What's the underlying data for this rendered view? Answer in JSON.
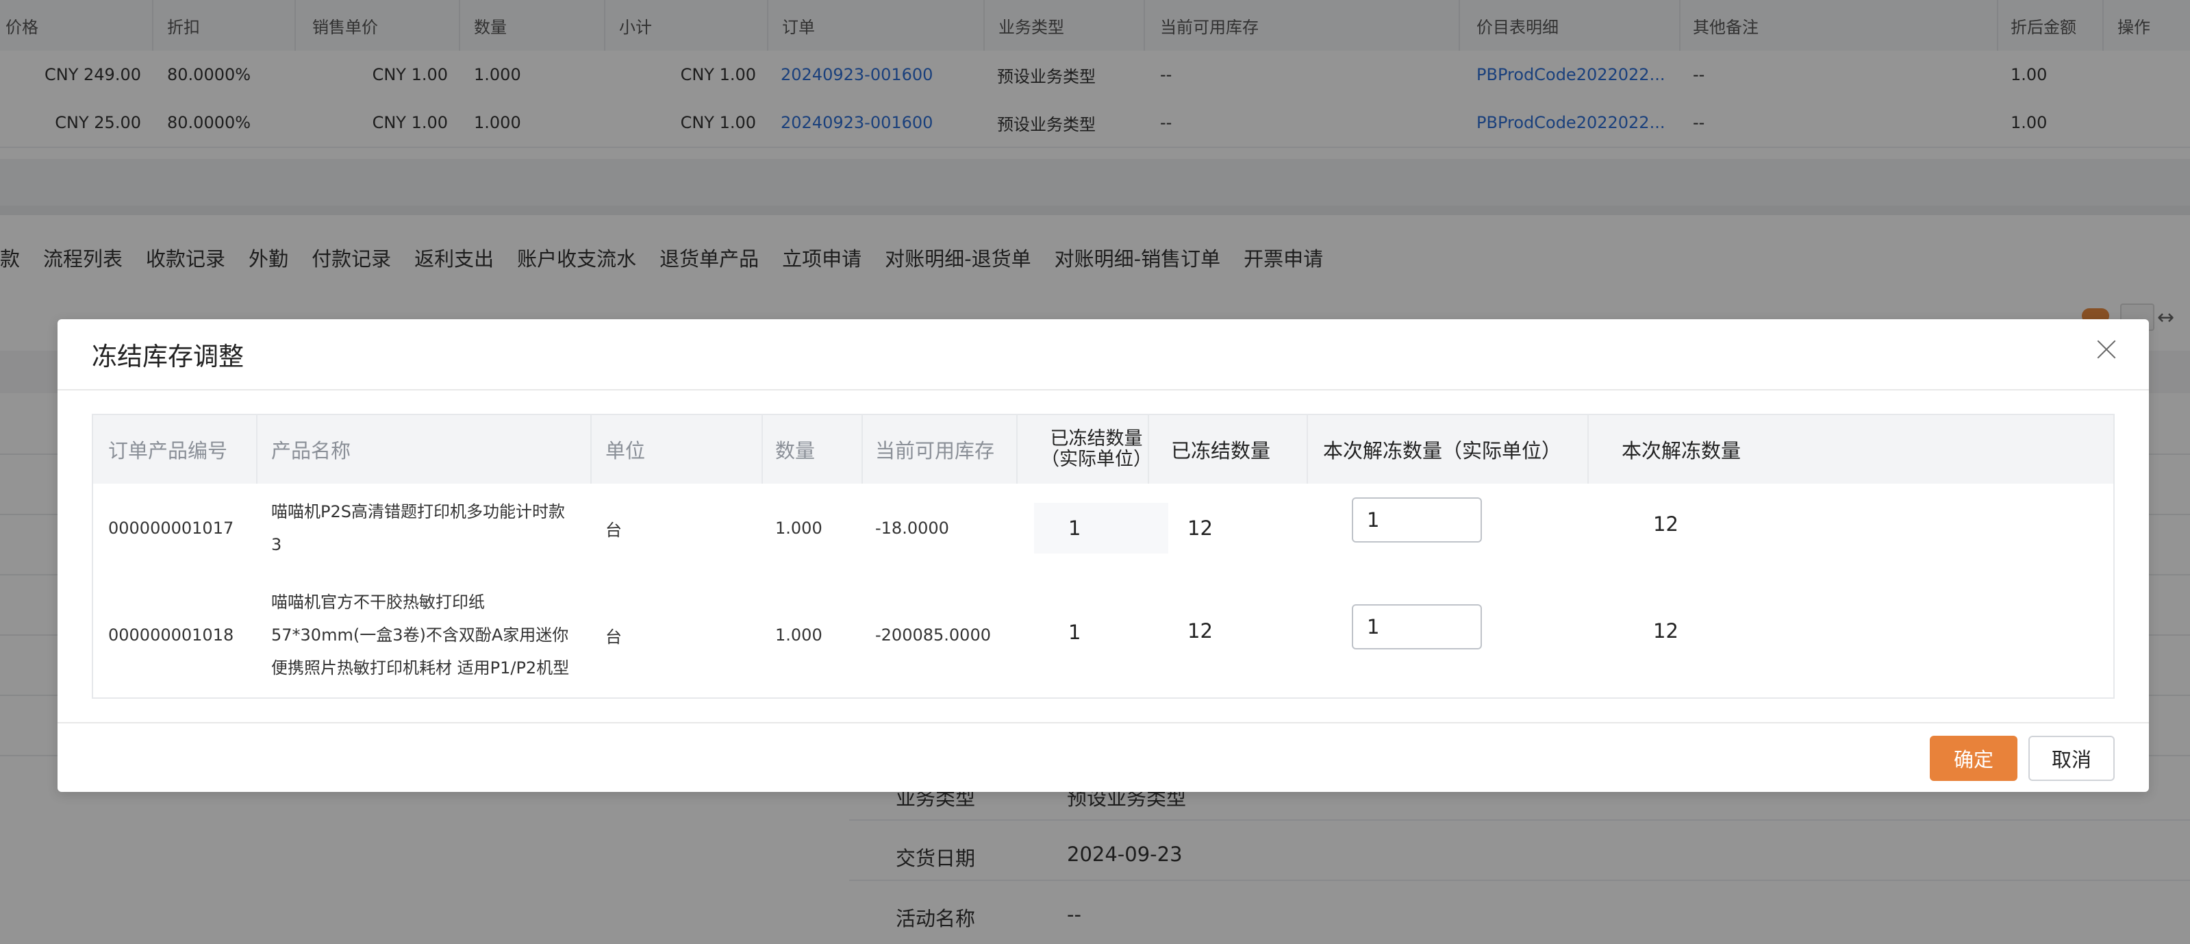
{
  "background_table": {
    "headers": [
      "价格",
      "折扣",
      "销售单价",
      "数量",
      "小计",
      "订单",
      "业务类型",
      "当前可用库存",
      "价目表明细",
      "其他备注",
      "折后金额",
      "操作"
    ],
    "rows": [
      [
        "CNY 249.00",
        "80.0000%",
        "CNY 1.00",
        "1.000",
        "CNY 1.00",
        "20240923-001600",
        "预设业务类型",
        "--",
        "PBProdCode2022022...",
        "--",
        "1.00",
        ""
      ],
      [
        "CNY 25.00",
        "80.0000%",
        "CNY 1.00",
        "1.000",
        "CNY 1.00",
        "20240923-001600",
        "预设业务类型",
        "--",
        "PBProdCode2022022...",
        "--",
        "1.00",
        ""
      ]
    ]
  },
  "tabs": [
    "款",
    "流程列表",
    "收款记录",
    "外勤",
    "付款记录",
    "返利支出",
    "账户收支流水",
    "退货单产品",
    "立项申请",
    "对账明细-退货单",
    "对账明细-销售订单",
    "开票申请"
  ],
  "details": [
    {
      "label": "业务类型",
      "value": "预设业务类型"
    },
    {
      "label": "交货日期",
      "value": "2024-09-23"
    },
    {
      "label": "活动名称",
      "value": "--"
    }
  ],
  "modal": {
    "title": "冻结库存调整",
    "columns": {
      "code": "订单产品编号",
      "name": "产品名称",
      "unit": "单位",
      "qty": "数量",
      "stock": "当前可用库存",
      "frozen_actual_line1": "已冻结数量",
      "frozen_actual_line2": "（实际单位）",
      "frozen": "已冻结数量",
      "unfreeze_actual": "本次解冻数量（实际单位）",
      "unfreeze": "本次解冻数量"
    },
    "rows": [
      {
        "code": "000000001017",
        "name": "喵喵机P2S高清错题打印机多功能计时款3",
        "unit": "台",
        "qty": "1.000",
        "stock": "-18.0000",
        "frozen_actual": "1",
        "frozen": "12",
        "unfreeze_actual": "1",
        "unfreeze": "12"
      },
      {
        "code": "000000001018",
        "name": "喵喵机官方不干胶热敏打印纸57*30mm(一盒3卷)不含双酚A家用迷你便携照片热敏打印机耗材 适用P1/P2机型",
        "unit": "台",
        "qty": "1.000",
        "stock": "-200085.0000",
        "frozen_actual": "1",
        "frozen": "12",
        "unfreeze_actual": "1",
        "unfreeze": "12"
      }
    ],
    "confirm_label": "确定",
    "cancel_label": "取消"
  },
  "colors": {
    "primary": "#e8823a",
    "link": "#2e6fd6",
    "overlay": "rgba(0,0,0,0.42)"
  }
}
